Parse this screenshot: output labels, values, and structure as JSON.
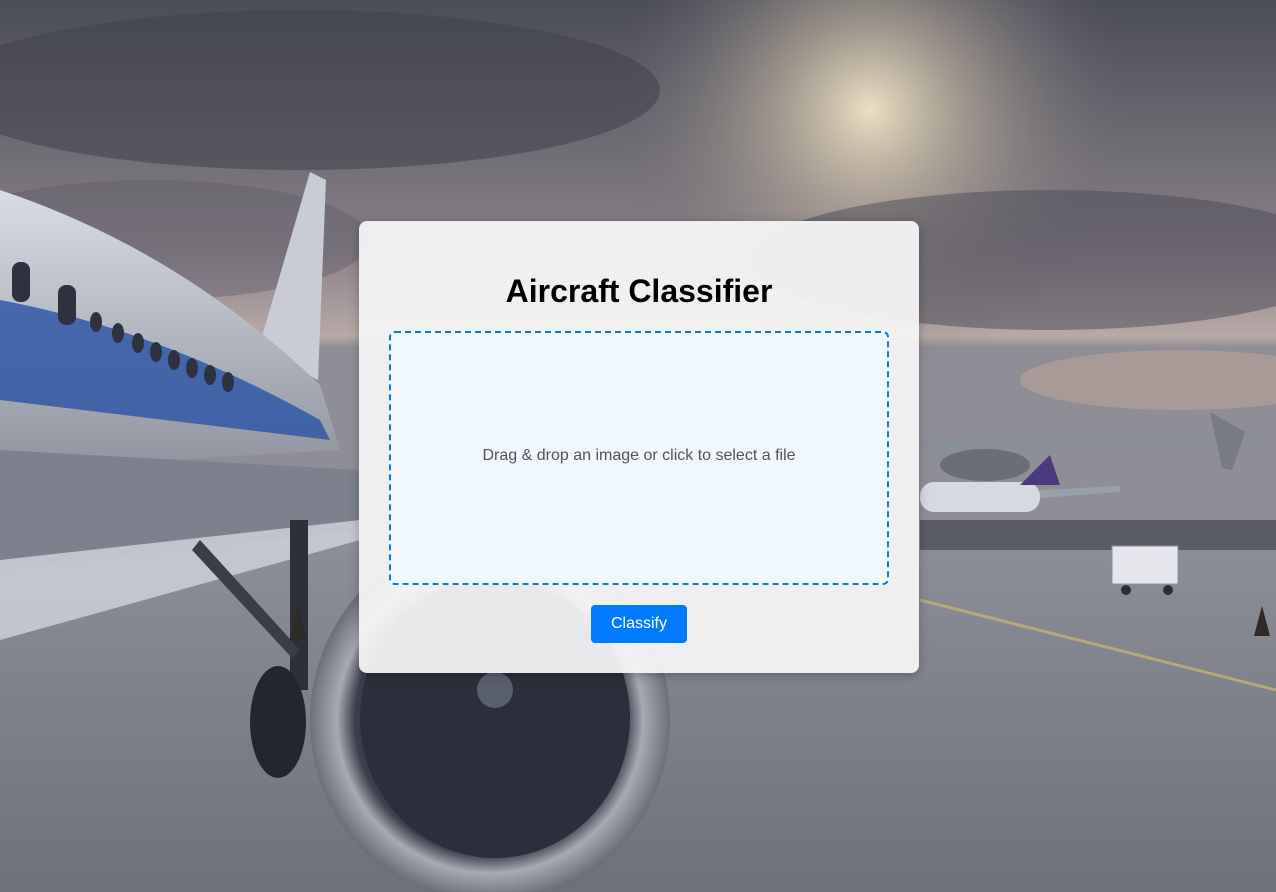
{
  "page": {
    "title": "Aircraft Classifier"
  },
  "dropzone": {
    "text": "Drag & drop an image or click to select a file"
  },
  "actions": {
    "classify_label": "Classify"
  },
  "colors": {
    "accent": "#007bff",
    "dropzone_border": "#0a7bd6",
    "dropzone_bg": "#f0f7ff",
    "panel_bg": "#f5f5f6"
  },
  "background": {
    "scene": "airport-apron-aircraft-photo"
  }
}
